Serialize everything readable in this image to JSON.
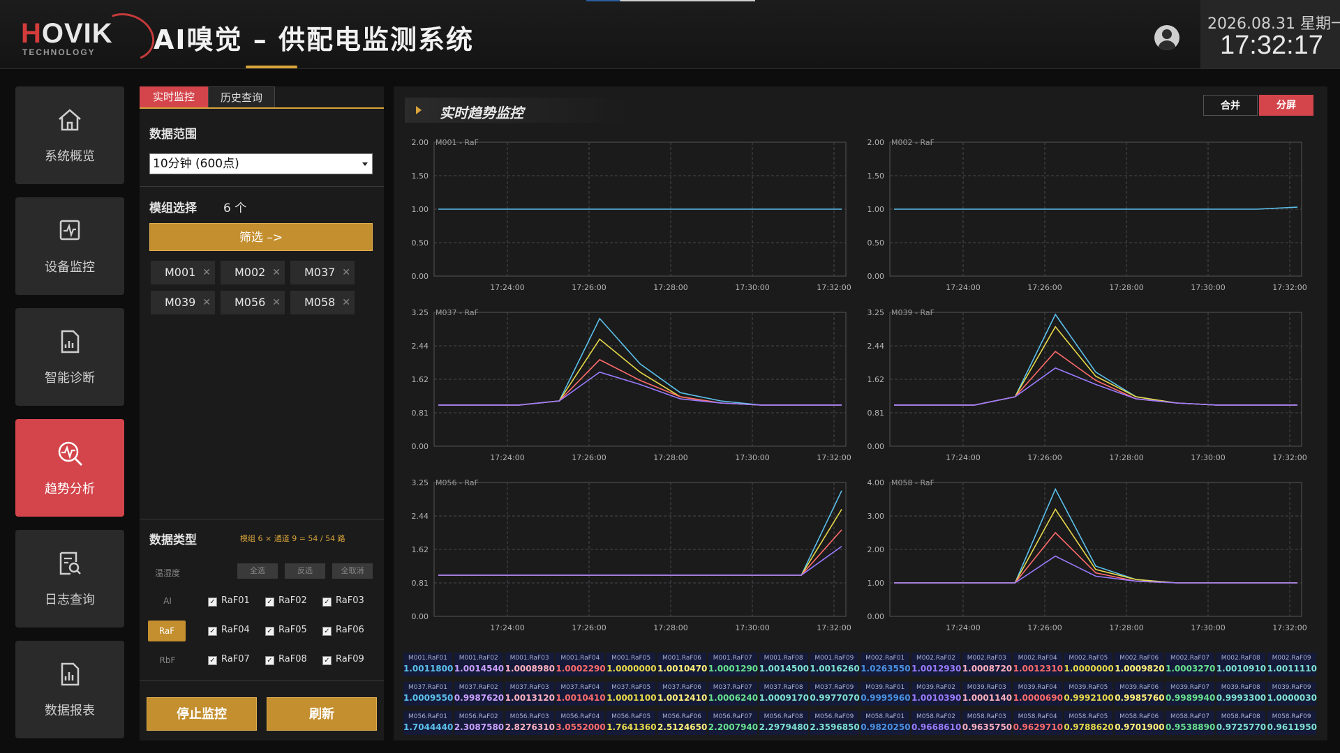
{
  "header": {
    "logo_brand_red": "H",
    "logo_brand_white": "OVIK",
    "logo_sub": "TECHNOLOGY",
    "title": "AI嗅觉 – 供配电监测系统",
    "date": "2026.08.31 星期一",
    "time": "17:32:17"
  },
  "nav": [
    {
      "label": "系统概览",
      "icon": "home-icon"
    },
    {
      "label": "设备监控",
      "icon": "monitor-icon"
    },
    {
      "label": "智能诊断",
      "icon": "report-icon"
    },
    {
      "label": "趋势分析",
      "icon": "trend-icon",
      "active": true
    },
    {
      "label": "日志查询",
      "icon": "log-search-icon"
    },
    {
      "label": "数据报表",
      "icon": "chart-report-icon"
    }
  ],
  "panel": {
    "tabs": [
      "实时监控",
      "历史查询"
    ],
    "range_label": "数据范围",
    "range_value": "10分钟 (600点)",
    "module_label": "模组选择",
    "module_count": "6 个",
    "filter_button": "筛选 –>",
    "chips": [
      "M001",
      "M002",
      "M037",
      "M039",
      "M056",
      "M058"
    ],
    "data_type_label": "数据类型",
    "data_type_note": "模组 6 × 通道 9 = 54 / 54 路",
    "select_all": "全选",
    "invert": "反选",
    "clear_all": "全取消",
    "types": [
      "温湿度",
      "AI",
      "RaF",
      "RbF"
    ],
    "channels": [
      "RaF01",
      "RaF02",
      "RaF03",
      "RaF04",
      "RaF05",
      "RaF06",
      "RaF07",
      "RaF08",
      "RaF09"
    ],
    "stop_button": "停止监控",
    "refresh_button": "刷新"
  },
  "main": {
    "title": "实时趋势监控",
    "merge": "合并",
    "split": "分屏"
  },
  "colors": {
    "accent_red": "#d3454b",
    "accent_gold": "#c48f2f",
    "series": [
      "#5bc0eb",
      "#e6d84a",
      "#ff6b6b",
      "#9b7bff",
      "#67e08f",
      "#ff9f43",
      "#4a90e2",
      "#e056fd",
      "#7ee0d0"
    ]
  },
  "chart_data": [
    {
      "type": "line",
      "title": "M001 - RaF",
      "x_ticks": [
        "17:24:00",
        "17:26:00",
        "17:28:00",
        "17:30:00",
        "17:32:00"
      ],
      "y_ticks": [
        "2.00",
        "1.50",
        "1.00",
        "0.50",
        "0.00"
      ],
      "ylim": [
        0,
        2
      ],
      "series": [
        {
          "values": [
            1.0,
            1.0,
            1.0,
            1.0,
            1.0,
            1.0,
            1.0,
            1.0,
            1.0,
            1.0,
            1.0
          ]
        }
      ]
    },
    {
      "type": "line",
      "title": "M002 - RaF",
      "x_ticks": [
        "17:24:00",
        "17:26:00",
        "17:28:00",
        "17:30:00",
        "17:32:00"
      ],
      "y_ticks": [
        "2.00",
        "1.50",
        "1.00",
        "0.50",
        "0.00"
      ],
      "ylim": [
        0,
        2
      ],
      "series": [
        {
          "values": [
            1.0,
            1.0,
            1.0,
            1.0,
            1.0,
            1.0,
            1.0,
            1.0,
            1.0,
            1.0,
            1.03
          ]
        }
      ]
    },
    {
      "type": "line",
      "title": "M037 - RaF",
      "x_ticks": [
        "17:24:00",
        "17:26:00",
        "17:28:00",
        "17:30:00",
        "17:32:00"
      ],
      "y_ticks": [
        "3.25",
        "2.44",
        "1.62",
        "0.81",
        "0.00"
      ],
      "ylim": [
        0,
        3.25
      ],
      "series": [
        {
          "values": [
            1.0,
            1.0,
            1.0,
            1.1,
            3.1,
            2.0,
            1.3,
            1.1,
            1.0,
            1.0,
            1.0
          ]
        },
        {
          "values": [
            1.0,
            1.0,
            1.0,
            1.1,
            2.6,
            1.8,
            1.2,
            1.05,
            1.0,
            1.0,
            1.0
          ]
        },
        {
          "values": [
            1.0,
            1.0,
            1.0,
            1.1,
            2.1,
            1.6,
            1.2,
            1.05,
            1.0,
            1.0,
            1.0
          ]
        },
        {
          "values": [
            1.0,
            1.0,
            1.0,
            1.1,
            1.8,
            1.5,
            1.15,
            1.05,
            1.0,
            1.0,
            1.0
          ]
        }
      ]
    },
    {
      "type": "line",
      "title": "M039 - RaF",
      "x_ticks": [
        "17:24:00",
        "17:26:00",
        "17:28:00",
        "17:30:00",
        "17:32:00"
      ],
      "y_ticks": [
        "3.25",
        "2.44",
        "1.62",
        "0.81",
        "0.00"
      ],
      "ylim": [
        0,
        3.25
      ],
      "series": [
        {
          "values": [
            1.0,
            1.0,
            1.0,
            1.2,
            3.2,
            1.8,
            1.2,
            1.05,
            1.0,
            1.0,
            1.0
          ]
        },
        {
          "values": [
            1.0,
            1.0,
            1.0,
            1.2,
            2.9,
            1.7,
            1.2,
            1.05,
            1.0,
            1.0,
            1.0
          ]
        },
        {
          "values": [
            1.0,
            1.0,
            1.0,
            1.2,
            2.3,
            1.6,
            1.15,
            1.05,
            1.0,
            1.0,
            1.0
          ]
        },
        {
          "values": [
            1.0,
            1.0,
            1.0,
            1.2,
            1.9,
            1.5,
            1.15,
            1.05,
            1.0,
            1.0,
            1.0
          ]
        }
      ]
    },
    {
      "type": "line",
      "title": "M056 - RaF",
      "x_ticks": [
        "17:24:00",
        "17:26:00",
        "17:28:00",
        "17:30:00",
        "17:32:00"
      ],
      "y_ticks": [
        "3.25",
        "2.44",
        "1.62",
        "0.81",
        "0.00"
      ],
      "ylim": [
        0,
        3.25
      ],
      "series": [
        {
          "values": [
            1.0,
            1.0,
            1.0,
            1.0,
            1.0,
            1.0,
            1.0,
            1.0,
            1.0,
            1.0,
            3.05
          ]
        },
        {
          "values": [
            1.0,
            1.0,
            1.0,
            1.0,
            1.0,
            1.0,
            1.0,
            1.0,
            1.0,
            1.0,
            2.6
          ]
        },
        {
          "values": [
            1.0,
            1.0,
            1.0,
            1.0,
            1.0,
            1.0,
            1.0,
            1.0,
            1.0,
            1.0,
            2.1
          ]
        },
        {
          "values": [
            1.0,
            1.0,
            1.0,
            1.0,
            1.0,
            1.0,
            1.0,
            1.0,
            1.0,
            1.0,
            1.7
          ]
        }
      ]
    },
    {
      "type": "line",
      "title": "M058 - RaF",
      "x_ticks": [
        "17:24:00",
        "17:26:00",
        "17:28:00",
        "17:30:00",
        "17:32:00"
      ],
      "y_ticks": [
        "4.00",
        "3.00",
        "2.00",
        "1.00",
        "0.00"
      ],
      "ylim": [
        0,
        4
      ],
      "series": [
        {
          "values": [
            1.0,
            1.0,
            1.0,
            1.0,
            3.8,
            1.5,
            1.1,
            1.0,
            1.0,
            1.0,
            1.0
          ]
        },
        {
          "values": [
            1.0,
            1.0,
            1.0,
            1.0,
            3.2,
            1.4,
            1.1,
            1.0,
            1.0,
            1.0,
            1.0
          ]
        },
        {
          "values": [
            1.0,
            1.0,
            1.0,
            1.0,
            2.5,
            1.3,
            1.05,
            1.0,
            1.0,
            1.0,
            1.0
          ]
        },
        {
          "values": [
            1.0,
            1.0,
            1.0,
            1.0,
            1.8,
            1.2,
            1.05,
            1.0,
            1.0,
            1.0,
            1.0
          ]
        }
      ]
    }
  ],
  "value_rows": [
    [
      {
        "k": "M001.RaF01",
        "v": "1.0011800",
        "c": "#5bc0eb"
      },
      {
        "k": "M001.RaF02",
        "v": "1.0014540",
        "c": "#c9a0ff"
      },
      {
        "k": "M001.RaF03",
        "v": "1.0008980",
        "c": "#ffb0c0"
      },
      {
        "k": "M001.RaF04",
        "v": "1.0002290",
        "c": "#ff6b6b"
      },
      {
        "k": "M001.RaF05",
        "v": "1.0000000",
        "c": "#e6d84a"
      },
      {
        "k": "M001.RaF06",
        "v": "1.0010470",
        "c": "#fff07a"
      },
      {
        "k": "M001.RaF07",
        "v": "1.0001290",
        "c": "#67e08f"
      },
      {
        "k": "M001.RaF08",
        "v": "1.0014500",
        "c": "#7ee0d0"
      },
      {
        "k": "M001.RaF09",
        "v": "1.0016260",
        "c": "#7ee0d0"
      },
      {
        "k": "M002.RaF01",
        "v": "1.0263550",
        "c": "#4a90e2"
      },
      {
        "k": "M002.RaF02",
        "v": "1.0012930",
        "c": "#9b7bff"
      },
      {
        "k": "M002.RaF03",
        "v": "1.0008720",
        "c": "#ffb0c0"
      },
      {
        "k": "M002.RaF04",
        "v": "1.0012310",
        "c": "#ff6b6b"
      },
      {
        "k": "M002.RaF05",
        "v": "1.0000000",
        "c": "#e6d84a"
      },
      {
        "k": "M002.RaF06",
        "v": "1.0009820",
        "c": "#fff07a"
      },
      {
        "k": "M002.RaF07",
        "v": "1.0003270",
        "c": "#67e08f"
      },
      {
        "k": "M002.RaF08",
        "v": "1.0010910",
        "c": "#7ee0d0"
      },
      {
        "k": "M002.RaF09",
        "v": "1.0011110",
        "c": "#7ee0d0"
      }
    ],
    [
      {
        "k": "M037.RaF01",
        "v": "1.0009550",
        "c": "#5bc0eb"
      },
      {
        "k": "M037.RaF02",
        "v": "0.9987620",
        "c": "#c9a0ff"
      },
      {
        "k": "M037.RaF03",
        "v": "1.0013120",
        "c": "#ffb0c0"
      },
      {
        "k": "M037.RaF04",
        "v": "1.0010410",
        "c": "#ff6b6b"
      },
      {
        "k": "M037.RaF05",
        "v": "1.0001100",
        "c": "#e6d84a"
      },
      {
        "k": "M037.RaF06",
        "v": "1.0012410",
        "c": "#fff07a"
      },
      {
        "k": "M037.RaF07",
        "v": "1.0006240",
        "c": "#67e08f"
      },
      {
        "k": "M037.RaF08",
        "v": "1.0009170",
        "c": "#7ee0d0"
      },
      {
        "k": "M037.RaF09",
        "v": "0.9977070",
        "c": "#7ee0d0"
      },
      {
        "k": "M039.RaF01",
        "v": "0.9995960",
        "c": "#4a90e2"
      },
      {
        "k": "M039.RaF02",
        "v": "1.0010390",
        "c": "#9b7bff"
      },
      {
        "k": "M039.RaF03",
        "v": "1.0001140",
        "c": "#ffb0c0"
      },
      {
        "k": "M039.RaF04",
        "v": "1.0000690",
        "c": "#ff6b6b"
      },
      {
        "k": "M039.RaF05",
        "v": "0.9992100",
        "c": "#e6d84a"
      },
      {
        "k": "M039.RaF06",
        "v": "0.9985760",
        "c": "#fff07a"
      },
      {
        "k": "M039.RaF07",
        "v": "0.9989940",
        "c": "#67e08f"
      },
      {
        "k": "M039.RaF08",
        "v": "0.9993300",
        "c": "#7ee0d0"
      },
      {
        "k": "M039.RaF09",
        "v": "1.0000030",
        "c": "#7ee0d0"
      }
    ],
    [
      {
        "k": "M056.RaF01",
        "v": "1.7044440",
        "c": "#5bc0eb"
      },
      {
        "k": "M056.RaF02",
        "v": "2.3087580",
        "c": "#c9a0ff"
      },
      {
        "k": "M056.RaF03",
        "v": "2.8276310",
        "c": "#ffb0c0"
      },
      {
        "k": "M056.RaF04",
        "v": "3.0552000",
        "c": "#ff6b6b"
      },
      {
        "k": "M056.RaF05",
        "v": "1.7641360",
        "c": "#e6d84a"
      },
      {
        "k": "M056.RaF06",
        "v": "2.5124650",
        "c": "#fff07a"
      },
      {
        "k": "M056.RaF07",
        "v": "2.2007940",
        "c": "#67e08f"
      },
      {
        "k": "M056.RaF08",
        "v": "2.2979480",
        "c": "#7ee0d0"
      },
      {
        "k": "M056.RaF09",
        "v": "2.3596850",
        "c": "#7ee0d0"
      },
      {
        "k": "M058.RaF01",
        "v": "0.9820250",
        "c": "#4a90e2"
      },
      {
        "k": "M058.RaF02",
        "v": "0.9668610",
        "c": "#9b7bff"
      },
      {
        "k": "M058.RaF03",
        "v": "0.9635750",
        "c": "#ffb0c0"
      },
      {
        "k": "M058.RaF04",
        "v": "0.9629710",
        "c": "#ff6b6b"
      },
      {
        "k": "M058.RaF05",
        "v": "0.9788620",
        "c": "#e6d84a"
      },
      {
        "k": "M058.RaF06",
        "v": "0.9701900",
        "c": "#fff07a"
      },
      {
        "k": "M058.RaF07",
        "v": "0.9538890",
        "c": "#67e08f"
      },
      {
        "k": "M058.RaF08",
        "v": "0.9725770",
        "c": "#7ee0d0"
      },
      {
        "k": "M058.RaF09",
        "v": "0.9611950",
        "c": "#7ee0d0"
      }
    ]
  ]
}
